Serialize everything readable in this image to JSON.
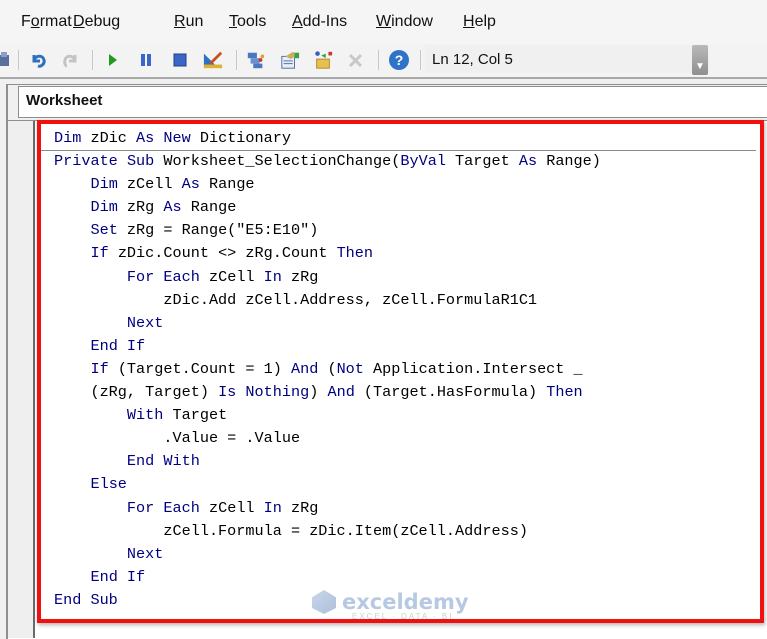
{
  "menu": {
    "items": [
      {
        "label": "Format",
        "accel": "o"
      },
      {
        "label": "Debug",
        "accel": "D"
      },
      {
        "label": "Run",
        "accel": "R"
      },
      {
        "label": "Tools",
        "accel": "T"
      },
      {
        "label": "Add-Ins",
        "accel": "A"
      },
      {
        "label": "Window",
        "accel": "W"
      },
      {
        "label": "Help",
        "accel": "H"
      }
    ]
  },
  "toolbar": {
    "icons": [
      "find-icon",
      "undo-icon",
      "redo-icon",
      "run-icon",
      "break-icon",
      "reset-icon",
      "design-mode-icon",
      "project-explorer-icon",
      "properties-window-icon",
      "object-browser-icon",
      "toolbox-icon",
      "help-icon"
    ],
    "cursor_position": "Ln 12, Col 5"
  },
  "object_combo": {
    "value": "Worksheet"
  },
  "code": {
    "declarations": [
      [
        {
          "t": "Dim",
          "k": true
        },
        {
          "t": " zDic "
        },
        {
          "t": "As",
          "k": true
        },
        {
          "t": " "
        },
        {
          "t": "New",
          "k": true
        },
        {
          "t": " Dictionary"
        }
      ]
    ],
    "lines": [
      [
        {
          "t": "Private",
          "k": true
        },
        {
          "t": " "
        },
        {
          "t": "Sub",
          "k": true
        },
        {
          "t": " Worksheet_SelectionChange("
        },
        {
          "t": "ByVal",
          "k": true
        },
        {
          "t": " Target "
        },
        {
          "t": "As",
          "k": true
        },
        {
          "t": " Range)"
        }
      ],
      [
        {
          "t": "    "
        },
        {
          "t": "Dim",
          "k": true
        },
        {
          "t": " zCell "
        },
        {
          "t": "As",
          "k": true
        },
        {
          "t": " Range"
        }
      ],
      [
        {
          "t": "    "
        },
        {
          "t": "Dim",
          "k": true
        },
        {
          "t": " zRg "
        },
        {
          "t": "As",
          "k": true
        },
        {
          "t": " Range"
        }
      ],
      [
        {
          "t": "    "
        },
        {
          "t": "Set",
          "k": true
        },
        {
          "t": " zRg = Range(\"E5:E10\")"
        }
      ],
      [
        {
          "t": "    "
        },
        {
          "t": "If",
          "k": true
        },
        {
          "t": " zDic.Count <> zRg.Count "
        },
        {
          "t": "Then",
          "k": true
        }
      ],
      [
        {
          "t": "        "
        },
        {
          "t": "For",
          "k": true
        },
        {
          "t": " "
        },
        {
          "t": "Each",
          "k": true
        },
        {
          "t": " zCell "
        },
        {
          "t": "In",
          "k": true
        },
        {
          "t": " zRg"
        }
      ],
      [
        {
          "t": "            zDic.Add zCell.Address, zCell.FormulaR1C1"
        }
      ],
      [
        {
          "t": "        "
        },
        {
          "t": "Next",
          "k": true
        }
      ],
      [
        {
          "t": "    "
        },
        {
          "t": "End If",
          "k": true
        }
      ],
      [
        {
          "t": "    "
        },
        {
          "t": "If",
          "k": true
        },
        {
          "t": " (Target.Count = 1) "
        },
        {
          "t": "And",
          "k": true
        },
        {
          "t": " ("
        },
        {
          "t": "Not",
          "k": true
        },
        {
          "t": " Application.Intersect _"
        }
      ],
      [
        {
          "t": "    (zRg, Target) "
        },
        {
          "t": "Is",
          "k": true
        },
        {
          "t": " "
        },
        {
          "t": "Nothing",
          "k": true
        },
        {
          "t": ") "
        },
        {
          "t": "And",
          "k": true
        },
        {
          "t": " (Target.HasFormula) "
        },
        {
          "t": "Then",
          "k": true
        }
      ],
      [
        {
          "t": "        "
        },
        {
          "t": "With",
          "k": true
        },
        {
          "t": " Target"
        }
      ],
      [
        {
          "t": "            .Value = .Value"
        }
      ],
      [
        {
          "t": "        "
        },
        {
          "t": "End With",
          "k": true
        }
      ],
      [
        {
          "t": "    "
        },
        {
          "t": "Else",
          "k": true
        }
      ],
      [
        {
          "t": "        "
        },
        {
          "t": "For",
          "k": true
        },
        {
          "t": " "
        },
        {
          "t": "Each",
          "k": true
        },
        {
          "t": " zCell "
        },
        {
          "t": "In",
          "k": true
        },
        {
          "t": " zRg"
        }
      ],
      [
        {
          "t": "            zCell.Formula = zDic.Item(zCell.Address)"
        }
      ],
      [
        {
          "t": "        "
        },
        {
          "t": "Next",
          "k": true
        }
      ],
      [
        {
          "t": "    "
        },
        {
          "t": "End If",
          "k": true
        }
      ],
      [
        {
          "t": "End Sub",
          "k": true
        }
      ]
    ]
  },
  "colors": {
    "keyword": "#00007f",
    "highlight_border": "#f01010"
  },
  "watermark": {
    "name": "exceldemy",
    "tagline": "EXCEL · DATA · BI"
  }
}
